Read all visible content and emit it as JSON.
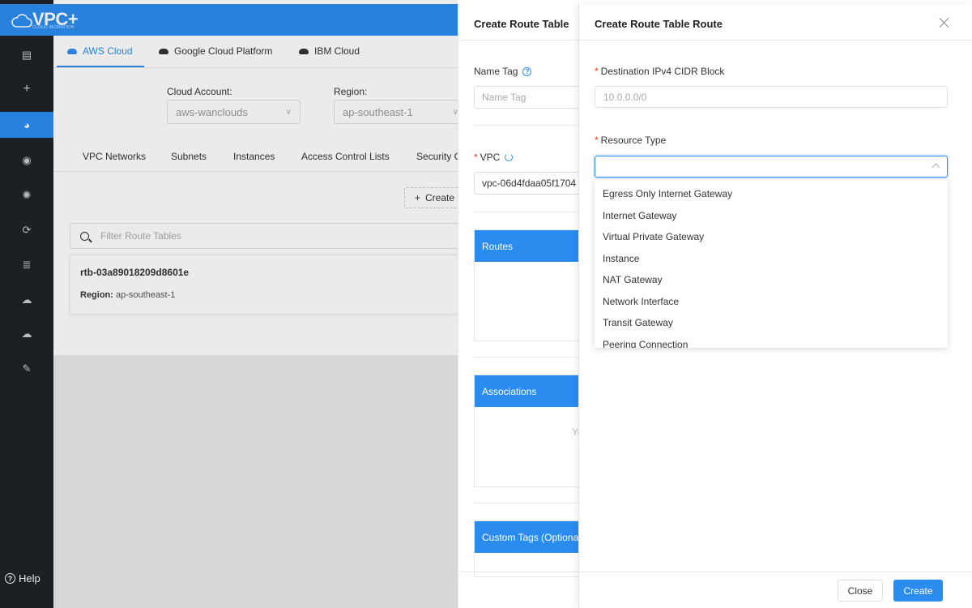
{
  "app": {
    "logo_text": "VPC+",
    "logo_sub": "CLOUD MIGRATION",
    "help_label": "Help"
  },
  "sidebar": {
    "items": [
      {
        "icon": "clipboard-icon",
        "glyph": "▤"
      },
      {
        "icon": "plus-icon",
        "glyph": "+"
      },
      {
        "icon": "dashboard-icon",
        "glyph": "◕",
        "active": true
      },
      {
        "icon": "compass-icon",
        "glyph": "◉"
      },
      {
        "icon": "network-icon",
        "glyph": "✺"
      },
      {
        "icon": "cloud-sync-icon",
        "glyph": "⟳"
      },
      {
        "icon": "server-icon",
        "glyph": "≣"
      },
      {
        "icon": "cloud-upload-icon",
        "glyph": "☁"
      },
      {
        "icon": "cloud-icon",
        "glyph": "☁"
      },
      {
        "icon": "wrench-icon",
        "glyph": "✎"
      }
    ]
  },
  "cloud_tabs": [
    "AWS Cloud",
    "Google Cloud Platform",
    "IBM Cloud"
  ],
  "filters": {
    "cloud_account_label": "Cloud Account:",
    "cloud_account_value": "aws-wanclouds",
    "region_label": "Region:",
    "region_value": "ap-southeast-1"
  },
  "sub_tabs": [
    "VPC Networks",
    "Subnets",
    "Instances",
    "Access Control Lists",
    "Security G"
  ],
  "create_button": "Create",
  "filter_placeholder": "Filter Route Tables",
  "route_table": {
    "name": "rtb-03a89018209d8601e",
    "region_label": "Region:",
    "region_value": "ap-southeast-1"
  },
  "drawer1": {
    "title": "Create Route Table",
    "name_tag_label": "Name Tag",
    "name_tag_placeholder": "Name Tag",
    "vpc_label": "VPC",
    "vpc_value": "vpc-06d4fdaa05f1704",
    "routes_label": "Routes",
    "associations_label": "Associations",
    "associations_partial": "Yo",
    "custom_tags_label": "Custom Tags (Optional)"
  },
  "drawer2": {
    "title": "Create Route Table Route",
    "cidr_label": "Destination IPv4 CIDR Block",
    "cidr_placeholder": "10.0.0.0/0",
    "resource_type_label": "Resource Type",
    "resource_options": [
      "Egress Only Internet Gateway",
      "Internet Gateway",
      "Virtual Private Gateway",
      "Instance",
      "NAT Gateway",
      "Network Interface",
      "Transit Gateway",
      "Peering Connection"
    ],
    "close_button": "Close",
    "create_button": "Create"
  }
}
